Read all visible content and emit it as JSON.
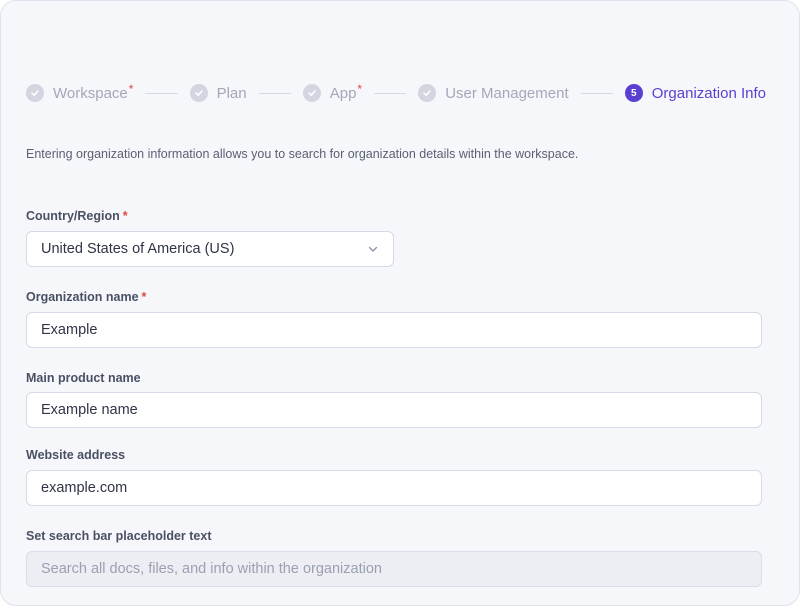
{
  "stepper": {
    "steps": [
      {
        "label": "Workspace",
        "required": "*",
        "state": "done"
      },
      {
        "label": "Plan",
        "required": "",
        "state": "done"
      },
      {
        "label": "App",
        "required": "*",
        "state": "done"
      },
      {
        "label": "User Management",
        "required": "",
        "state": "done"
      },
      {
        "label": "Organization Info",
        "required": "",
        "state": "active",
        "number": "5"
      }
    ]
  },
  "description": "Entering organization information allows you to search for organization details within the workspace.",
  "form": {
    "country": {
      "label": "Country/Region",
      "required": "*",
      "value": "United States of America (US)"
    },
    "org_name": {
      "label": "Organization name",
      "required": "*",
      "value": "Example"
    },
    "product_name": {
      "label": "Main product name",
      "value": "Example name"
    },
    "website": {
      "label": "Website address",
      "value": "example.com"
    },
    "search_placeholder": {
      "label": "Set search bar placeholder text",
      "placeholder": "Search all docs, files, and info within the organization"
    }
  },
  "colors": {
    "accent": "#5b3fd1",
    "required": "#e0483a",
    "done_step": "#d3d6e1"
  }
}
